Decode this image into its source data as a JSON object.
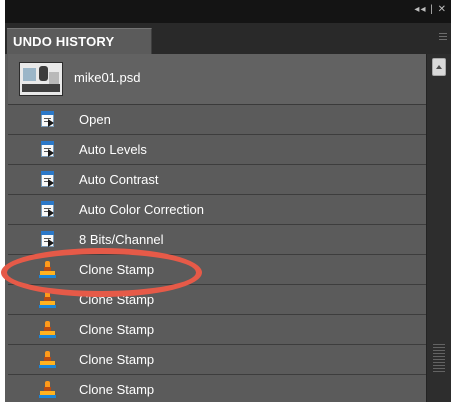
{
  "titlebar": {
    "controls": "◂◂ | ✕"
  },
  "panel": {
    "title": "UNDO HISTORY",
    "menu_icon": "panel-menu-icon"
  },
  "snapshot": {
    "name": "mike01.psd",
    "thumbnail_icon": "snapshot-thumbnail"
  },
  "history": [
    {
      "label": "Open",
      "icon": "document-arrow-icon"
    },
    {
      "label": "Auto Levels",
      "icon": "document-arrow-icon"
    },
    {
      "label": "Auto Contrast",
      "icon": "document-arrow-icon"
    },
    {
      "label": "Auto Color Correction",
      "icon": "document-arrow-icon"
    },
    {
      "label": "8 Bits/Channel",
      "icon": "document-arrow-icon"
    },
    {
      "label": "Clone Stamp",
      "icon": "clone-stamp-icon"
    },
    {
      "label": "Clone Stamp",
      "icon": "clone-stamp-icon"
    },
    {
      "label": "Clone Stamp",
      "icon": "clone-stamp-icon"
    },
    {
      "label": "Clone Stamp",
      "icon": "clone-stamp-icon"
    },
    {
      "label": "Clone Stamp",
      "icon": "clone-stamp-icon"
    }
  ],
  "annotation": {
    "color": "#e65a48"
  },
  "colors": {
    "panel_bg": "#5b5b5b",
    "topbar_bg": "#141414",
    "tabbar_bg": "#292929",
    "text": "#ffffff",
    "row_divider": "#3d3d3d",
    "accent_blue": "#2b78c8",
    "stamp_orange": "#ffb21f"
  }
}
